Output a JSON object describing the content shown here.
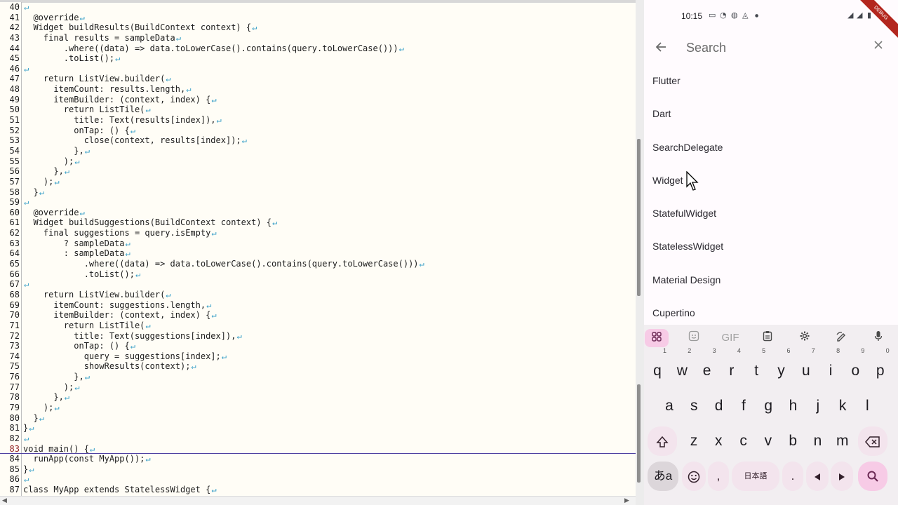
{
  "editor": {
    "lines": [
      {
        "num": "40",
        "code": ""
      },
      {
        "num": "41",
        "code": "  @override"
      },
      {
        "num": "42",
        "code": "  Widget buildResults(BuildContext context) {"
      },
      {
        "num": "43",
        "code": "    final results = sampleData"
      },
      {
        "num": "44",
        "code": "        .where((data) => data.toLowerCase().contains(query.toLowerCase()))"
      },
      {
        "num": "45",
        "code": "        .toList();"
      },
      {
        "num": "46",
        "code": ""
      },
      {
        "num": "47",
        "code": "    return ListView.builder("
      },
      {
        "num": "48",
        "code": "      itemCount: results.length,"
      },
      {
        "num": "49",
        "code": "      itemBuilder: (context, index) {"
      },
      {
        "num": "50",
        "code": "        return ListTile("
      },
      {
        "num": "51",
        "code": "          title: Text(results[index]),"
      },
      {
        "num": "52",
        "code": "          onTap: () {"
      },
      {
        "num": "53",
        "code": "            close(context, results[index]);"
      },
      {
        "num": "54",
        "code": "          },"
      },
      {
        "num": "55",
        "code": "        );"
      },
      {
        "num": "56",
        "code": "      },"
      },
      {
        "num": "57",
        "code": "    );"
      },
      {
        "num": "58",
        "code": "  }"
      },
      {
        "num": "59",
        "code": ""
      },
      {
        "num": "60",
        "code": "  @override"
      },
      {
        "num": "61",
        "code": "  Widget buildSuggestions(BuildContext context) {"
      },
      {
        "num": "62",
        "code": "    final suggestions = query.isEmpty"
      },
      {
        "num": "63",
        "code": "        ? sampleData"
      },
      {
        "num": "64",
        "code": "        : sampleData"
      },
      {
        "num": "65",
        "code": "            .where((data) => data.toLowerCase().contains(query.toLowerCase()))"
      },
      {
        "num": "66",
        "code": "            .toList();"
      },
      {
        "num": "67",
        "code": ""
      },
      {
        "num": "68",
        "code": "    return ListView.builder("
      },
      {
        "num": "69",
        "code": "      itemCount: suggestions.length,"
      },
      {
        "num": "70",
        "code": "      itemBuilder: (context, index) {"
      },
      {
        "num": "71",
        "code": "        return ListTile("
      },
      {
        "num": "72",
        "code": "          title: Text(suggestions[index]),"
      },
      {
        "num": "73",
        "code": "          onTap: () {"
      },
      {
        "num": "74",
        "code": "            query = suggestions[index];"
      },
      {
        "num": "75",
        "code": "            showResults(context);"
      },
      {
        "num": "76",
        "code": "          },"
      },
      {
        "num": "77",
        "code": "        );"
      },
      {
        "num": "78",
        "code": "      },"
      },
      {
        "num": "79",
        "code": "    );"
      },
      {
        "num": "80",
        "code": "  }"
      },
      {
        "num": "81",
        "code": "}"
      },
      {
        "num": "82",
        "code": ""
      },
      {
        "num": "83",
        "code": "void main() {"
      },
      {
        "num": "84",
        "code": "  runApp(const MyApp());"
      },
      {
        "num": "85",
        "code": "}"
      },
      {
        "num": "86",
        "code": ""
      },
      {
        "num": "87",
        "code": "class MyApp extends StatelessWidget {"
      }
    ],
    "return_mark": "↵",
    "active_line": "83",
    "scroll_left_arrow": "◀",
    "scroll_right_arrow": "▶"
  },
  "phone": {
    "status": {
      "time": "10:15",
      "debug_label": "DEBUG"
    },
    "app_bar": {
      "search_placeholder": "Search",
      "back_icon": "arrow-left-icon",
      "clear_icon": "close-icon"
    },
    "results": [
      "Flutter",
      "Dart",
      "SearchDelegate",
      "Widget",
      "StatefulWidget",
      "StatelessWidget",
      "Material Design",
      "Cupertino"
    ],
    "keyboard": {
      "toolbar": [
        "apps-grid-icon",
        "sticker-icon",
        "GIF",
        "clipboard-icon",
        "gear-icon",
        "handwriting-icon",
        "mic-icon"
      ],
      "row1": [
        {
          "k": "q",
          "n": "1"
        },
        {
          "k": "w",
          "n": "2"
        },
        {
          "k": "e",
          "n": "3"
        },
        {
          "k": "r",
          "n": "4"
        },
        {
          "k": "t",
          "n": "5"
        },
        {
          "k": "y",
          "n": "6"
        },
        {
          "k": "u",
          "n": "7"
        },
        {
          "k": "i",
          "n": "8"
        },
        {
          "k": "o",
          "n": "9"
        },
        {
          "k": "p",
          "n": "0"
        }
      ],
      "row2": [
        "a",
        "s",
        "d",
        "f",
        "g",
        "h",
        "j",
        "k",
        "l"
      ],
      "row3": [
        "z",
        "x",
        "c",
        "v",
        "b",
        "n",
        "m"
      ],
      "lang_key": "あa",
      "comma": ",",
      "space_label": "日本語",
      "period": ".",
      "accent_color": "#f7cbe6"
    }
  }
}
